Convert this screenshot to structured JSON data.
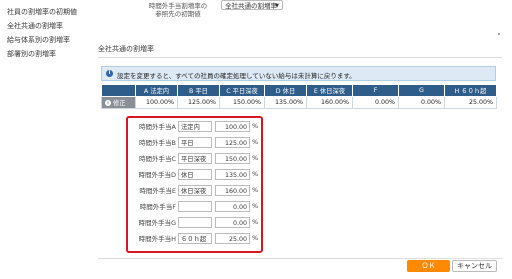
{
  "sidebar": {
    "items": [
      {
        "label": "社員の割増率の初期値"
      },
      {
        "label": "全社共通の割増率"
      },
      {
        "label": "給与体系別の割増率"
      },
      {
        "label": "部署別の割増率"
      }
    ]
  },
  "top": {
    "label_line1": "時間外手当割増率の",
    "label_line2": "参照先の初期値",
    "select_value": "全社共通の割増率"
  },
  "section": {
    "title": "全社共通の割増率",
    "info_text": "設定を変更すると、すべての社員の確定処理していない給与は未計算に戻ります。"
  },
  "table": {
    "headers": [
      "",
      "A 法定内",
      "B 平日",
      "C 平日深夜",
      "D 休日",
      "E 休日深夜",
      "F",
      "G",
      "H ６０ｈ超"
    ],
    "fix_label": "修正",
    "values": [
      "100.00%",
      "125.00%",
      "150.00%",
      "135.00%",
      "160.00%",
      "0.00%",
      "0.00%",
      "25.00%"
    ]
  },
  "edit_rows": [
    {
      "label": "時間外手当A",
      "name": "法定内",
      "value": "100.00",
      "unit": "%"
    },
    {
      "label": "時間外手当B",
      "name": "平日",
      "value": "125.00",
      "unit": "%"
    },
    {
      "label": "時間外手当C",
      "name": "平日深夜",
      "value": "150.00",
      "unit": "%"
    },
    {
      "label": "時間外手当D",
      "name": "休日",
      "value": "135.00",
      "unit": "%"
    },
    {
      "label": "時間外手当E",
      "name": "休日深夜",
      "value": "160.00",
      "unit": "%"
    },
    {
      "label": "時間外手当F",
      "name": "",
      "value": "0.00",
      "unit": "%"
    },
    {
      "label": "時間外手当G",
      "name": "",
      "value": "0.00",
      "unit": "%"
    },
    {
      "label": "時間外手当H",
      "name": "６０ｈ超",
      "value": "25.00",
      "unit": "%"
    }
  ],
  "buttons": {
    "ok": "ＯＫ",
    "cancel": "キャンセル"
  },
  "colors": {
    "header_blue": "#2f5d8a",
    "info_bg": "#dde9f5",
    "highlight_red": "#d8161f",
    "ok_orange": "#ff8a00"
  }
}
